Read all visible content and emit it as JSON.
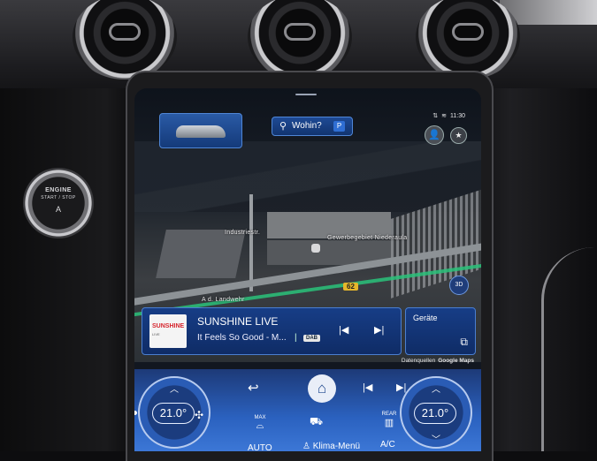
{
  "vehicle": {
    "engine_button": {
      "line1": "ENGINE",
      "line2": "START / STOP",
      "icon": "A"
    }
  },
  "statusbar": {
    "time": "11:30",
    "signal_icon": "signal-icon",
    "connectivity_icon": "connectivity-icon"
  },
  "navigation": {
    "search_label": "Wohin?",
    "search_badge": "P",
    "map_labels": {
      "street1": "Industriestr.",
      "area": "Gewerbegebiet Niederaula",
      "street2": "A d. Landwehr",
      "road_number": "62"
    },
    "view_mode_label": "3D",
    "attribution": {
      "prefix": "Datenquellen",
      "provider": "Google Maps"
    }
  },
  "media": {
    "station": "SUNSHINE LIVE",
    "song": "It Feels So Good - M...",
    "separator": "|",
    "source_badge": "DAB",
    "logo_text": "SUNSHINE",
    "logo_sub": "LIVE"
  },
  "devices": {
    "label": "Geräte"
  },
  "climate": {
    "left_temp": "21.0°",
    "right_temp": "21.0°",
    "max_label": "MAX",
    "rear_label": "REAR",
    "auto_label": "AUTO",
    "klima_menu_label": "Klima-Menü",
    "ac_label": "A/C"
  },
  "colors": {
    "accent_blue": "#1e4a95",
    "button_border": "#4a7ed0",
    "route_green": "#2ac27a",
    "ac_indicator": "#ff3b30"
  }
}
